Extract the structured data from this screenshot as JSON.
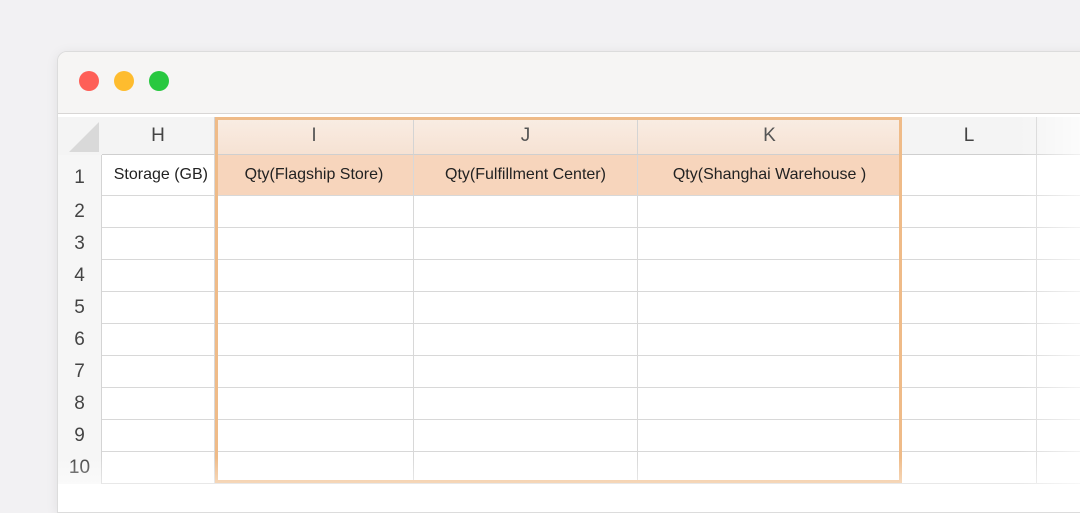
{
  "window": {
    "controls": [
      "close",
      "minimize",
      "maximize"
    ]
  },
  "spreadsheet": {
    "columns": [
      "H",
      "I",
      "J",
      "K",
      "L"
    ],
    "selected_columns": [
      "I",
      "J",
      "K"
    ],
    "rows": [
      "1",
      "2",
      "3",
      "4",
      "5",
      "6",
      "7",
      "8",
      "9",
      "10"
    ],
    "header_row": {
      "H": "Storage (GB)",
      "I": "Qty(Flagship Store)",
      "J": "Qty(Fulfillment Center)",
      "K": "Qty(Shanghai Warehouse )",
      "L": ""
    }
  },
  "colors": {
    "selection_border": "#efbb88",
    "selected_header_fill": "#f7d5bc",
    "close": "#fe5f57",
    "minimize": "#febc2e",
    "maximize": "#28c840"
  }
}
